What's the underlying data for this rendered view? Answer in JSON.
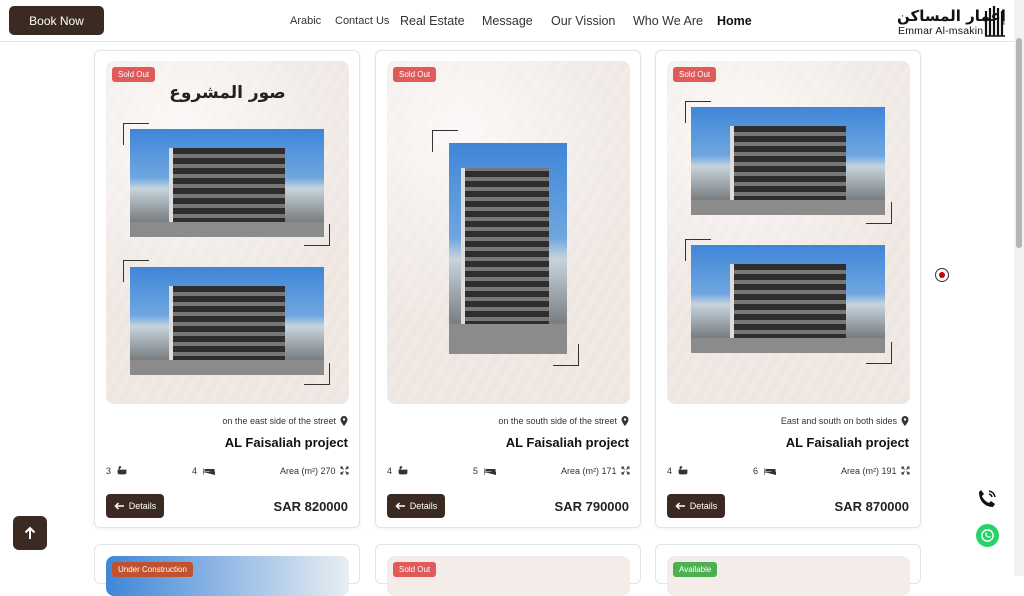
{
  "header": {
    "book_now": "Book Now",
    "nav": [
      "Arabic",
      "Contact Us",
      "Real Estate",
      "Message",
      "Our Vission",
      "Who We Are",
      "Home"
    ],
    "logo_ar": "إعمار المساكن",
    "logo_en": "Emmar Al-msakin"
  },
  "cards": [
    {
      "status": "Sold Out",
      "status_color": "#e05a5a",
      "image_heading": "صور المشروع",
      "location": "on the east side of the street",
      "title": "AL Faisaliah project",
      "rooms": "3",
      "beds": "4",
      "area": "Area (m²) 270",
      "details": "Details",
      "price": "SAR 820000"
    },
    {
      "status": "Sold Out",
      "status_color": "#e05a5a",
      "location": "on the south side of the street",
      "title": "AL Faisaliah project",
      "rooms": "4",
      "beds": "5",
      "area": "Area (m²) 171",
      "details": "Details",
      "price": "SAR 790000"
    },
    {
      "status": "Sold Out",
      "status_color": "#e05a5a",
      "location": "East and south on both sides",
      "title": "AL Faisaliah project",
      "rooms": "4",
      "beds": "6",
      "area": "Area (m²) 191",
      "details": "Details",
      "price": "SAR 870000"
    }
  ],
  "next_row": [
    {
      "status": "Under Construction",
      "status_color": "#c0522e"
    },
    {
      "status": "Sold Out",
      "status_color": "#e05a5a"
    },
    {
      "status": "Available",
      "status_color": "#4caf50"
    }
  ],
  "icons": [
    "arrow-up-icon",
    "phone-icon",
    "whatsapp-icon",
    "location-pin-icon",
    "bathtub-icon",
    "bed-icon",
    "expand-icon",
    "arrow-left-icon"
  ]
}
